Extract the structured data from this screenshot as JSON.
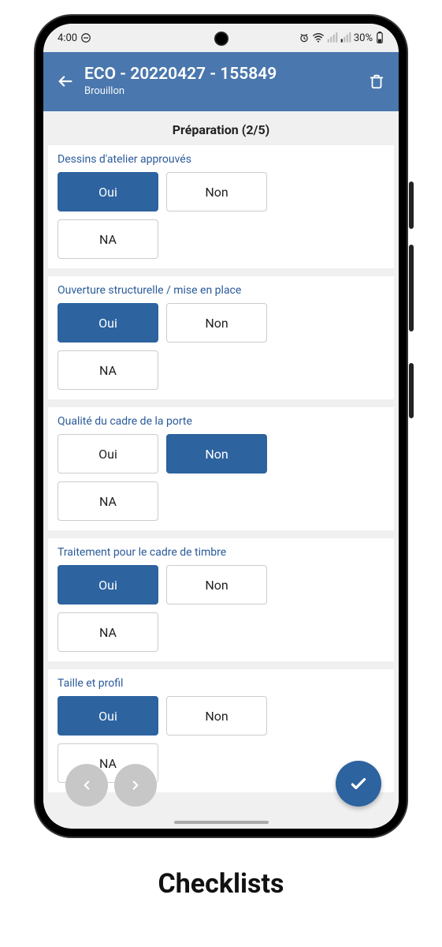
{
  "status": {
    "time": "4:00",
    "battery": "30%"
  },
  "header": {
    "title": "ECO - 20220427 - 155849",
    "subtitle": "Brouillon"
  },
  "section": {
    "title": "Préparation (2/5)"
  },
  "labels": {
    "oui": "Oui",
    "non": "Non",
    "na": "NA"
  },
  "questions": [
    {
      "label": "Dessins d'atelier approuvés",
      "selected": "oui"
    },
    {
      "label": "Ouverture structurelle / mise en place",
      "selected": "oui"
    },
    {
      "label": "Qualité du cadre de la porte",
      "selected": "non"
    },
    {
      "label": "Traitement pour le cadre de timbre",
      "selected": "oui"
    },
    {
      "label": "Taille et profil",
      "selected": "oui"
    }
  ],
  "caption": "Checklists"
}
